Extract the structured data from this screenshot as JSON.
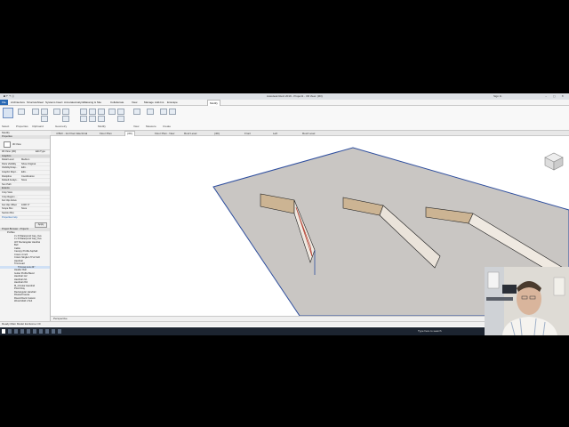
{
  "window": {
    "title": "Autodesk Revit 2019 - Project1 - 3D View: {3D}",
    "user": "Sign In",
    "controls": "– ▢ ✕",
    "quick_access": "◙ ↶ ↷ ⎙"
  },
  "ribbon_tabs": [
    "File",
    "Architecture",
    "Structure",
    "Steel",
    "Systems",
    "Insert",
    "Annotate",
    "Analyze",
    "Massing & Site",
    "Collaborate",
    "View",
    "Manage",
    "Add-Ins",
    "Enscape",
    "Modify"
  ],
  "active_tab": "Modify",
  "ribbon_panels": [
    "Select",
    "Properties",
    "Clipboard",
    "Geometry",
    "Modify",
    "View",
    "Measure",
    "Create"
  ],
  "options_bar": "Modify",
  "properties": {
    "header": "Properties",
    "type_name": "3D View",
    "instance": "3D View: {3D}",
    "edit_type": "Edit Type",
    "section_graphics": "Graphics",
    "rows": [
      {
        "label": "Detail Level",
        "value": "Medium"
      },
      {
        "label": "Parts Visibility",
        "value": "Show Original"
      },
      {
        "label": "Visibility/Grap...",
        "value": "Edit..."
      },
      {
        "label": "Graphic Displ...",
        "value": "Edit..."
      },
      {
        "label": "Discipline",
        "value": "Coordination"
      },
      {
        "label": "Default Analys...",
        "value": "None"
      },
      {
        "label": "Sun Path",
        "value": ""
      }
    ],
    "section_extents": "Extents",
    "rows2": [
      {
        "label": "Crop View",
        "value": ""
      },
      {
        "label": "Crop Region ...",
        "value": ""
      },
      {
        "label": "Far Clip Active",
        "value": ""
      },
      {
        "label": "Far Clip Offset",
        "value": "1000' 0\""
      },
      {
        "label": "Scope Box",
        "value": "None"
      },
      {
        "label": "Section Box",
        "value": ""
      }
    ],
    "help": "Properties help",
    "apply": "Apply"
  },
  "project_browser": {
    "header": "Project Browser - Project1",
    "items": [
      "Profiles",
      "3 x 8 Waterproof Cap_Ove",
      "3 x 8 Waterproof Cap_Ove",
      "3/4\" Rectangular Handrai",
      "Bull",
      "Cable",
      "Canopy Profile Asphalt",
      "Crown 4 inch",
      "Crown Single 1.5\"x2 Inch",
      "Handrail",
      "Trim/Load",
      "Trimcap Low 24\"",
      "Header Rail",
      "Gutter Profile Bevel",
      "Handrail 1x2",
      "Handrail 2x1",
      "Handrail 2X4",
      "M_Circular Handrail",
      "Pivot Dray",
      "Rectangular Handrail",
      "Riveted Fascia",
      "Round Deck Custom",
      "Wood Mold 1.5x4"
    ]
  },
  "view_tabs": [
    "4 Bldr - 1st Floor Electrical",
    "Floor Plan",
    "{3D}",
    "Floor Plan - New",
    "Roof Level",
    "{4D}",
    "Front",
    "Left",
    "Roof Level"
  ],
  "active_view_tab": "{3D}",
  "view_control_bar": "Perspective",
  "status_bar": "Ready    Main Model    Exclusive   ⊡0",
  "taskbar_search": "Type here to search"
}
